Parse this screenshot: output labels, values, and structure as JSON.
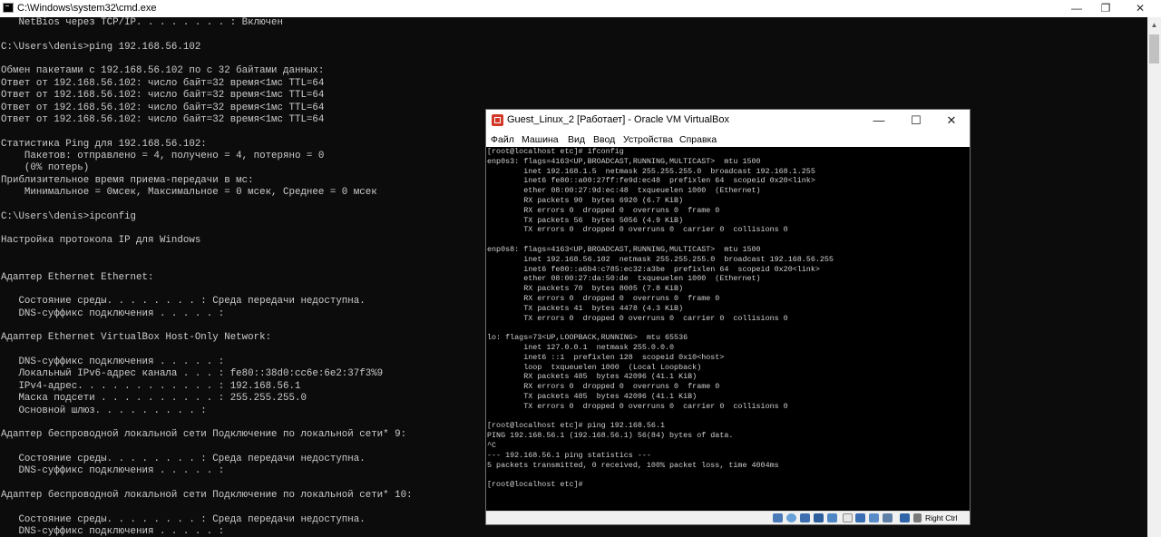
{
  "cmd_window": {
    "title": "C:\\Windows\\system32\\cmd.exe",
    "controls": {
      "minimize": "—",
      "maximize": "❐",
      "close": "✕"
    },
    "lines": [
      "   NetBios через TCP/IP. . . . . . . . : Включен",
      "",
      "C:\\Users\\denis>ping 192.168.56.102",
      "",
      "Обмен пакетами с 192.168.56.102 по с 32 байтами данных:",
      "Ответ от 192.168.56.102: число байт=32 время<1мс TTL=64",
      "Ответ от 192.168.56.102: число байт=32 время<1мс TTL=64",
      "Ответ от 192.168.56.102: число байт=32 время<1мс TTL=64",
      "Ответ от 192.168.56.102: число байт=32 время<1мс TTL=64",
      "",
      "Статистика Ping для 192.168.56.102:",
      "    Пакетов: отправлено = 4, получено = 4, потеряно = 0",
      "    (0% потерь)",
      "Приблизительное время приема-передачи в мс:",
      "    Минимальное = 0мсек, Максимальное = 0 мсек, Среднее = 0 мсек",
      "",
      "C:\\Users\\denis>ipconfig",
      "",
      "Настройка протокола IP для Windows",
      "",
      "",
      "Адаптер Ethernet Ethernet:",
      "",
      "   Состояние среды. . . . . . . . : Среда передачи недоступна.",
      "   DNS-суффикс подключения . . . . . :",
      "",
      "Адаптер Ethernet VirtualBox Host-Only Network:",
      "",
      "   DNS-суффикс подключения . . . . . :",
      "   Локальный IPv6-адрес канала . . . : fe80::38d0:cc6e:6e2:37f3%9",
      "   IPv4-адрес. . . . . . . . . . . . : 192.168.56.1",
      "   Маска подсети . . . . . . . . . . : 255.255.255.0",
      "   Основной шлюз. . . . . . . . . :",
      "",
      "Адаптер беспроводной локальной сети Подключение по локальной сети* 9:",
      "",
      "   Состояние среды. . . . . . . . : Среда передачи недоступна.",
      "   DNS-суффикс подключения . . . . . :",
      "",
      "Адаптер беспроводной локальной сети Подключение по локальной сети* 10:",
      "",
      "   Состояние среды. . . . . . . . : Среда передачи недоступна.",
      "   DNS-суффикс подключения . . . . . :"
    ]
  },
  "vbox_window": {
    "title": "Guest_Linux_2 [Работает] - Oracle VM VirtualBox",
    "controls": {
      "minimize": "—",
      "maximize": "☐",
      "close": "✕"
    },
    "menu": [
      "Файл",
      "Машина",
      "Вид",
      "Ввод",
      "Устройства",
      "Справка"
    ],
    "host_key": "Right Ctrl",
    "status_icons": [
      "hdd-icon",
      "optical-disk-icon",
      "network-icon",
      "usb-icon",
      "shared-folder-icon",
      "display-icon",
      "video-capture-icon",
      "cpu-icon",
      "mouse-integration-icon",
      "keyboard-icon"
    ],
    "guest_lines": [
      "[root@localhost etc]# ifconfig",
      "enp0s3: flags=4163<UP,BROADCAST,RUNNING,MULTICAST>  mtu 1500",
      "        inet 192.168.1.5  netmask 255.255.255.0  broadcast 192.168.1.255",
      "        inet6 fe80::a00:27ff:fe9d:ec48  prefixlen 64  scopeid 0x20<link>",
      "        ether 08:00:27:9d:ec:48  txqueuelen 1000  (Ethernet)",
      "        RX packets 90  bytes 6920 (6.7 KiB)",
      "        RX errors 0  dropped 0  overruns 0  frame 0",
      "        TX packets 56  bytes 5056 (4.9 KiB)",
      "        TX errors 0  dropped 0 overruns 0  carrier 0  collisions 0",
      "",
      "enp0s8: flags=4163<UP,BROADCAST,RUNNING,MULTICAST>  mtu 1500",
      "        inet 192.168.56.102  netmask 255.255.255.0  broadcast 192.168.56.255",
      "        inet6 fe80::a6b4:c785:ec32:a3be  prefixlen 64  scopeid 0x20<link>",
      "        ether 08:00:27:da:50:de  txqueuelen 1000  (Ethernet)",
      "        RX packets 70  bytes 8005 (7.8 KiB)",
      "        RX errors 0  dropped 0  overruns 0  frame 0",
      "        TX packets 41  bytes 4478 (4.3 KiB)",
      "        TX errors 0  dropped 0 overruns 0  carrier 0  collisions 0",
      "",
      "lo: flags=73<UP,LOOPBACK,RUNNING>  mtu 65536",
      "        inet 127.0.0.1  netmask 255.0.0.0",
      "        inet6 ::1  prefixlen 128  scopeid 0x10<host>",
      "        loop  txqueuelen 1000  (Local Loopback)",
      "        RX packets 485  bytes 42096 (41.1 KiB)",
      "        RX errors 0  dropped 0  overruns 0  frame 0",
      "        TX packets 485  bytes 42096 (41.1 KiB)",
      "        TX errors 0  dropped 0 overruns 0  carrier 0  collisions 0",
      "",
      "[root@localhost etc]# ping 192.168.56.1",
      "PING 192.168.56.1 (192.168.56.1) 56(84) bytes of data.",
      "^C",
      "--- 192.168.56.1 ping statistics ---",
      "5 packets transmitted, 0 received, 100% packet loss, time 4004ms",
      "",
      "[root@localhost etc]#"
    ]
  },
  "colors": {
    "console_bg": "#0c0c0c",
    "console_text": "#cccccc",
    "vbox_accent": "#d13828"
  }
}
